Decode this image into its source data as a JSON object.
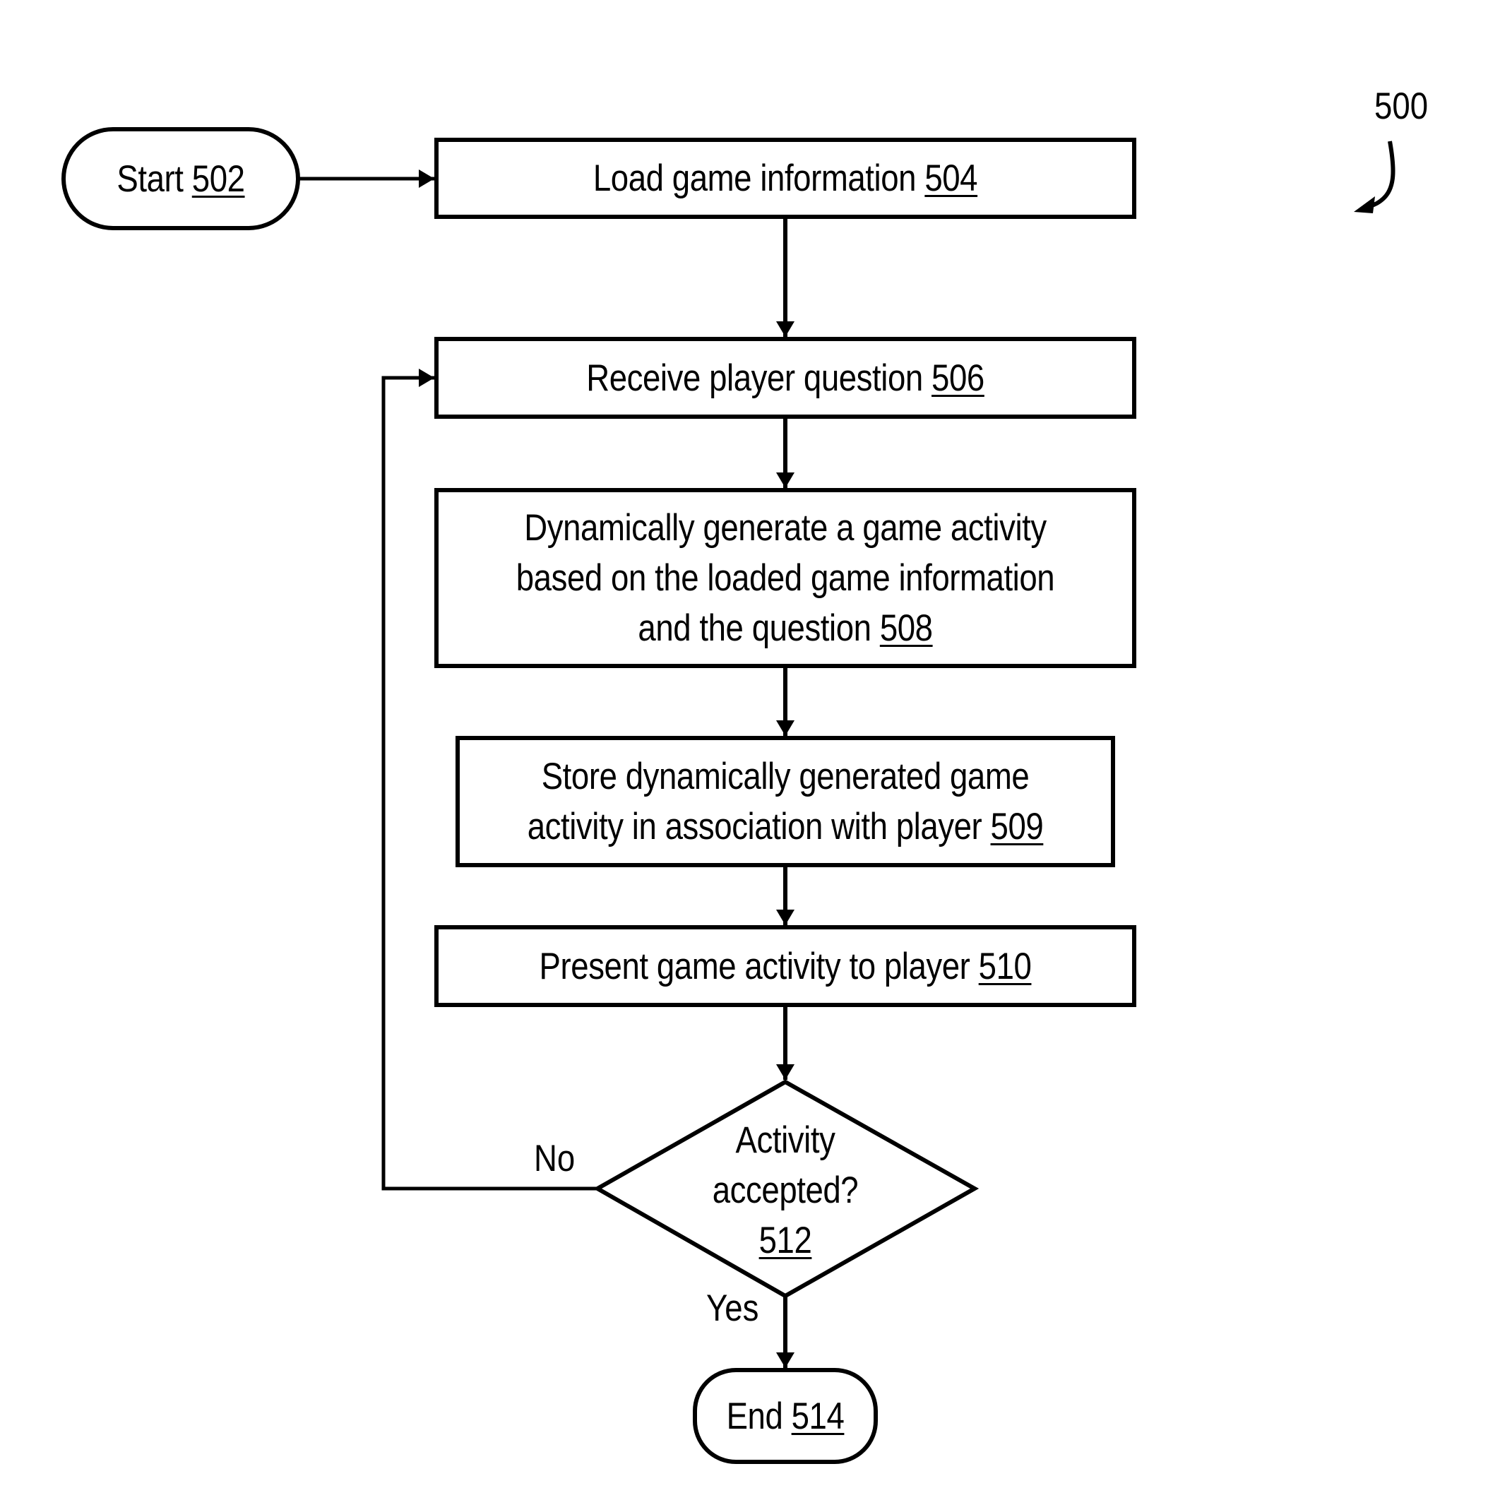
{
  "figure": {
    "ref": "500",
    "stroke_color": "#000000",
    "background": "#ffffff"
  },
  "nodes": {
    "start": {
      "text": "Start",
      "ref": "502",
      "shape": "terminal"
    },
    "load": {
      "text": "Load game information",
      "ref": "504",
      "shape": "process"
    },
    "receive": {
      "text": "Receive player question",
      "ref": "506",
      "shape": "process"
    },
    "generate": {
      "lines": [
        "Dynamically generate a game activity",
        "based on the loaded game information",
        "and the question"
      ],
      "ref": "508",
      "shape": "process"
    },
    "store": {
      "lines": [
        "Store dynamically generated game",
        "activity in association with player"
      ],
      "ref": "509",
      "shape": "process"
    },
    "present": {
      "text": "Present game activity to player",
      "ref": "510",
      "shape": "process"
    },
    "decision": {
      "lines": [
        "Activity",
        "accepted?"
      ],
      "ref": "512",
      "shape": "decision"
    },
    "end": {
      "text": "End",
      "ref": "514",
      "shape": "terminal"
    }
  },
  "edges": [
    {
      "from": "start",
      "to": "load",
      "label": ""
    },
    {
      "from": "load",
      "to": "receive",
      "label": ""
    },
    {
      "from": "receive",
      "to": "generate",
      "label": ""
    },
    {
      "from": "generate",
      "to": "store",
      "label": ""
    },
    {
      "from": "store",
      "to": "present",
      "label": ""
    },
    {
      "from": "present",
      "to": "decision",
      "label": ""
    },
    {
      "from": "decision",
      "to": "receive",
      "label": "No"
    },
    {
      "from": "decision",
      "to": "end",
      "label": "Yes"
    }
  ],
  "labels": {
    "no": "No",
    "yes": "Yes"
  }
}
